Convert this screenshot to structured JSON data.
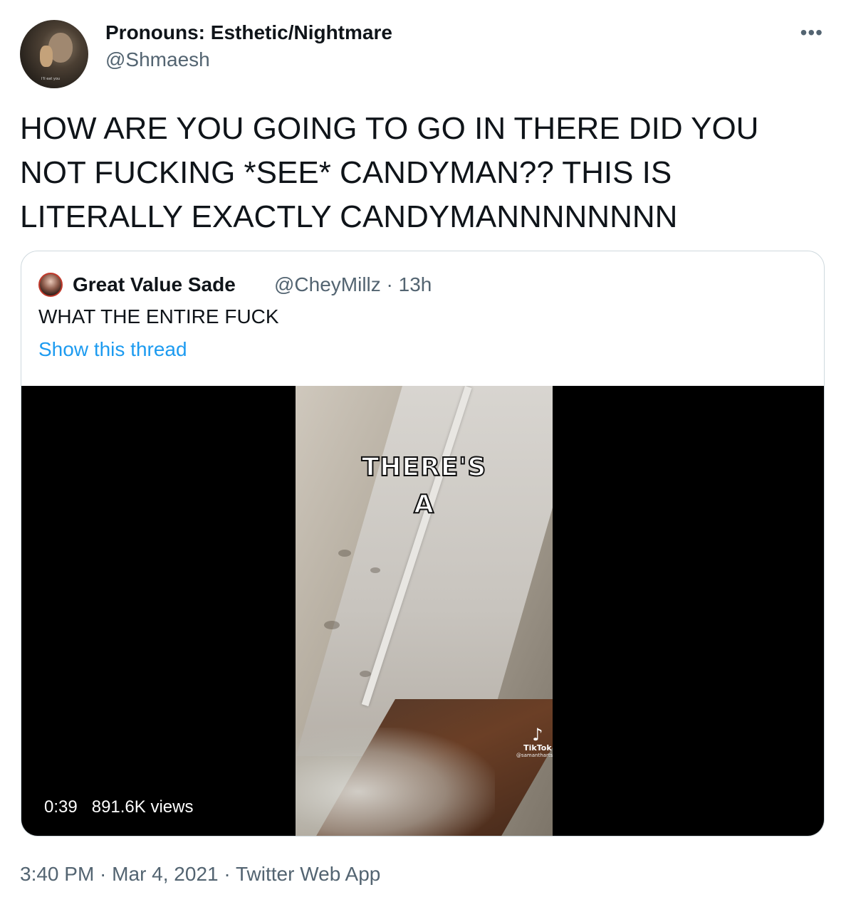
{
  "author": {
    "display_name": "Pronouns: Esthetic/Nightmare",
    "handle": "@Shmaesh",
    "avatar_caption": "I'll eat you"
  },
  "more_icon": "•••",
  "tweet_text": "HOW ARE YOU GOING TO GO IN THERE DID YOU NOT FUCKING *SEE* CANDYMAN?? THIS IS LITERALLY EXACTLY CANDYMANNNNNNNN",
  "quoted_tweet": {
    "display_name": "Great Value Sade",
    "handle_time": "@CheyMillz · 13h",
    "text": "WHAT THE ENTIRE FUCK",
    "show_thread": "Show this thread",
    "video": {
      "overlay_line1": "THERE'S",
      "overlay_line2": "A",
      "tiktok_brand": "TikTok",
      "tiktok_user": "@samanthartsoe",
      "duration": "0:39",
      "views": "891.6K views"
    }
  },
  "footer": {
    "time": "3:40 PM",
    "sep1": " · ",
    "date": "Mar 4, 2021",
    "sep2": " · ",
    "source": "Twitter Web App"
  },
  "colors": {
    "text": "#0f1419",
    "secondary": "#536471",
    "link": "#1d9bf0",
    "border": "#cfd9de"
  }
}
